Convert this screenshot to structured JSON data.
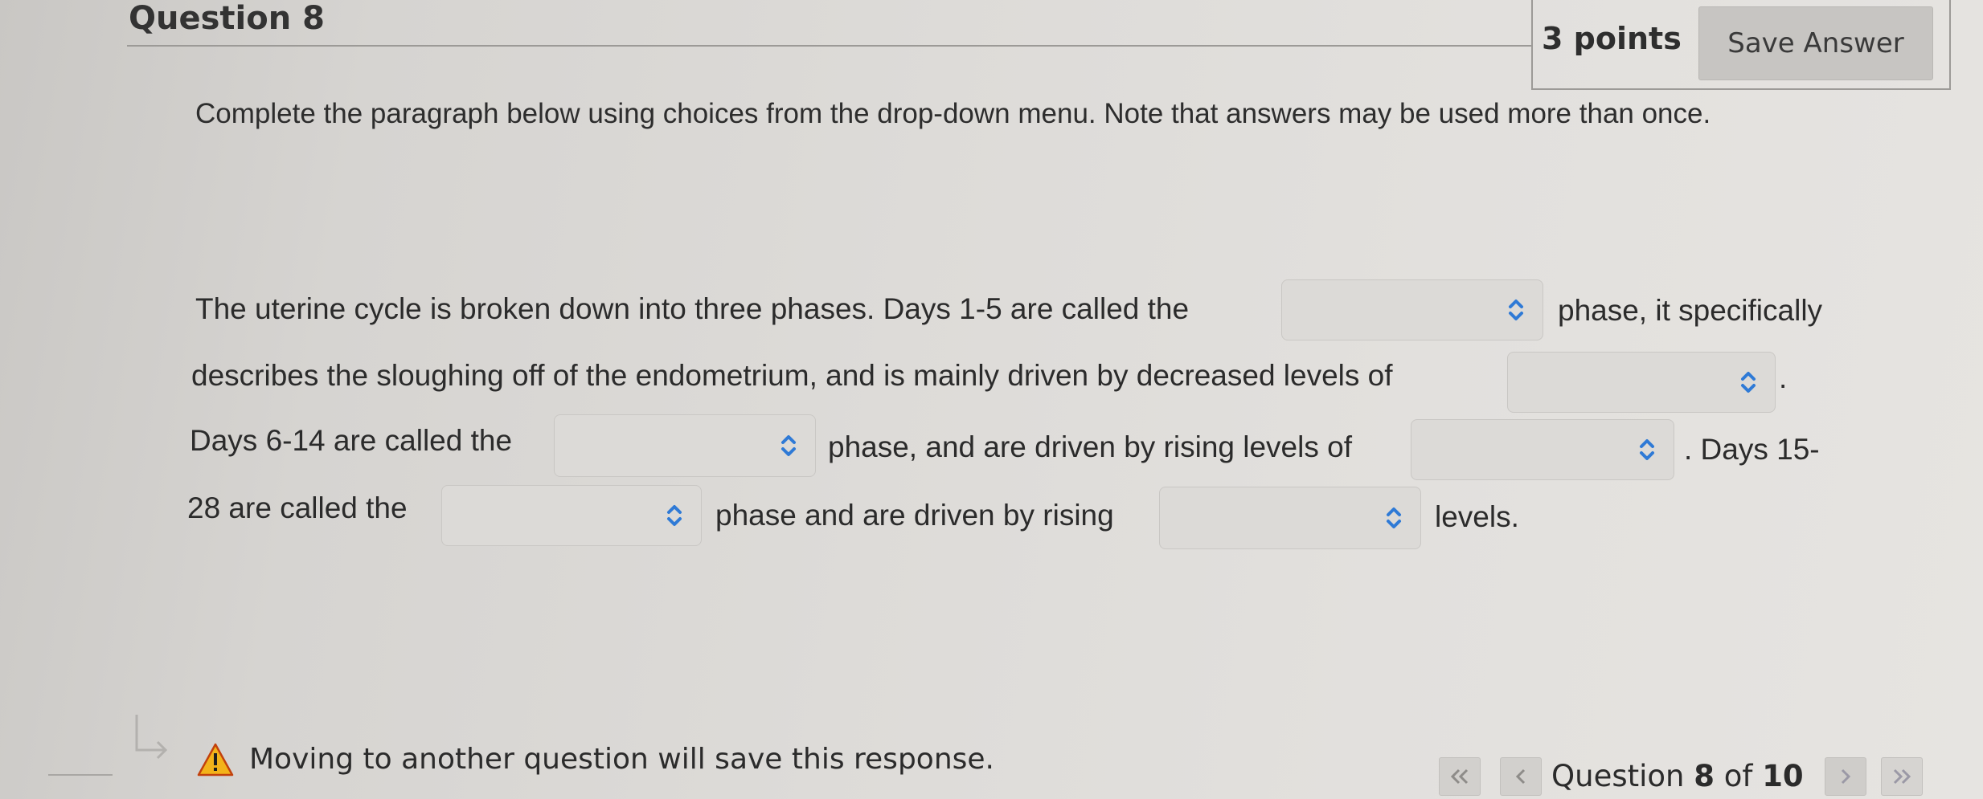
{
  "question": {
    "title": "Question 8",
    "points": "3 points",
    "save_label": "Save Answer",
    "instructions": "Complete the paragraph below using choices from the drop-down menu. Note that answers may be used more than once."
  },
  "paragraph": {
    "l1a": "The uterine cycle is broken down into three phases. Days 1-5 are called the",
    "l1b": "phase, it specifically",
    "l2a": "describes the sloughing off of the endometrium, and is mainly driven by decreased levels of",
    "l2b": ".",
    "l3a": "Days 6-14 are called the",
    "l3b": "phase, and are driven by rising levels of",
    "l3c": ". Days 15-",
    "l4a": "28 are called the",
    "l4b": "phase and are driven by rising",
    "l4c": "levels."
  },
  "dropdowns": [
    {
      "selected": ""
    },
    {
      "selected": ""
    },
    {
      "selected": ""
    },
    {
      "selected": ""
    },
    {
      "selected": ""
    },
    {
      "selected": ""
    }
  ],
  "footer": {
    "warning": "Moving to another question will save this response.",
    "nav_prefix": "Question ",
    "current": "8",
    "nav_mid": " of ",
    "total": "10",
    "first_icon": "double-chevron-left-icon",
    "prev_icon": "chevron-left-icon",
    "next_icon": "chevron-right-icon",
    "last_icon": "double-chevron-right-icon"
  },
  "colors": {
    "caret": "#2f7ad6",
    "warning_fill": "#f3b31a"
  }
}
